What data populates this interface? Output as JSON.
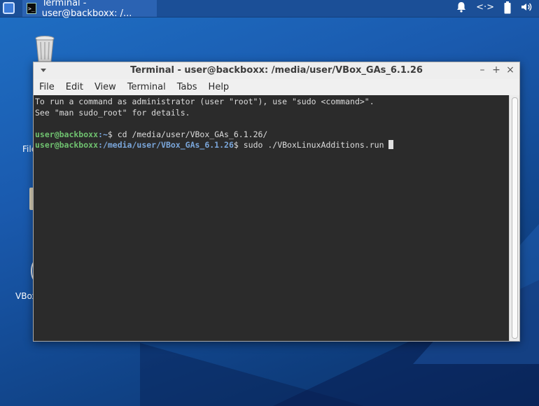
{
  "panel": {
    "task_title": "Terminal - user@backboxx: /...",
    "tray_network": "<·>"
  },
  "desktop": {
    "file_label": "File",
    "vbox_label": "VBox"
  },
  "window": {
    "title": "Terminal - user@backboxx: /media/user/VBox_GAs_6.1.26",
    "menu": [
      "File",
      "Edit",
      "View",
      "Terminal",
      "Tabs",
      "Help"
    ]
  },
  "terminal": {
    "line1": "To run a command as administrator (user \"root\"), use \"sudo <command>\".",
    "line2": "See \"man sudo_root\" for details.",
    "prompt1_user": "user@backboxx",
    "prompt1_path": ":~",
    "prompt1_cmd": "$ cd /media/user/VBox_GAs_6.1.26/",
    "prompt2_user": "user@backboxx",
    "prompt2_path": ":/media/user/VBox_GAs_6.1.26",
    "prompt2_cmd": "$ sudo ./VBoxLinuxAdditions.run "
  },
  "icons": {
    "app_menu": "app-menu-icon",
    "terminal_task": "terminal-icon",
    "bell": "bell-icon",
    "network": "network-icon",
    "battery": "battery-icon",
    "volume": "volume-icon",
    "trash": "trash-icon",
    "drive": "drive-icon",
    "disc": "disc-icon"
  }
}
